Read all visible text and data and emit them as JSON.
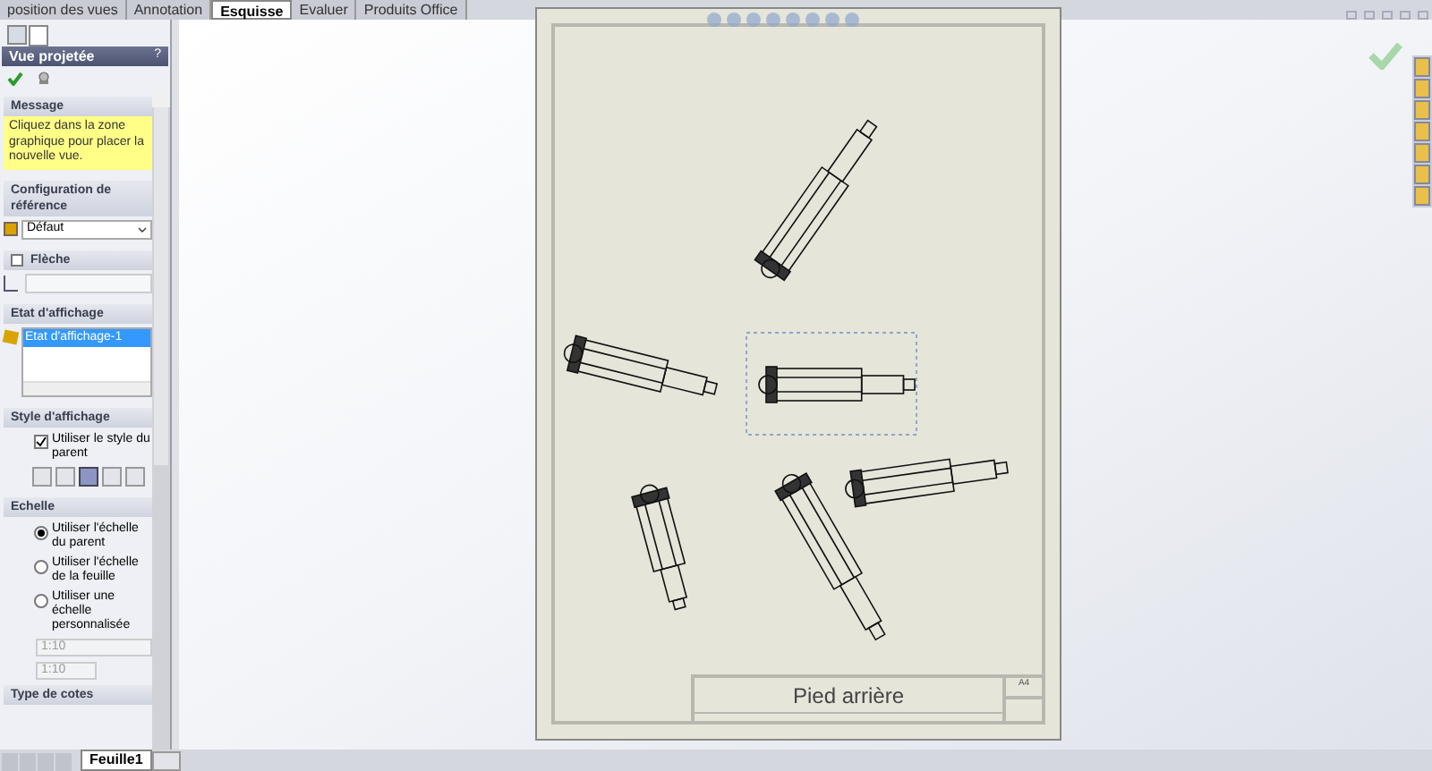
{
  "ribbon_tabs": [
    {
      "label": "position des vues",
      "selected": false
    },
    {
      "label": "Annotation",
      "selected": false
    },
    {
      "label": "Esquisse",
      "selected": true
    },
    {
      "label": "Evaluer",
      "selected": false
    },
    {
      "label": "Produits Office",
      "selected": false
    }
  ],
  "panel": {
    "title": "Vue projetée",
    "help": "?",
    "message": {
      "header": "Message",
      "text": "Cliquez dans la zone graphique pour placer la nouvelle vue."
    },
    "config": {
      "header": "Configuration de référence",
      "value": "Défaut"
    },
    "arrow": {
      "header": "Flèche",
      "checked": false
    },
    "display_state": {
      "header": "Etat d'affichage",
      "items": [
        {
          "label": "Etat d'affichage-1",
          "selected": true
        }
      ]
    },
    "display_style": {
      "header": "Style d'affichage",
      "use_parent": {
        "label": "Utiliser le style du parent",
        "checked": true
      },
      "buttons": [
        {
          "selected": false
        },
        {
          "selected": false
        },
        {
          "selected": true
        },
        {
          "selected": false
        },
        {
          "selected": false
        }
      ]
    },
    "scale": {
      "header": "Echelle",
      "options": [
        {
          "label": "Utiliser l'échelle du parent",
          "selected": true
        },
        {
          "label": "Utiliser l'échelle de la feuille",
          "selected": false
        },
        {
          "label": "Utiliser une échelle personnalisée",
          "selected": false
        }
      ],
      "custom_select": "1:10",
      "custom_field": "1:10"
    },
    "next_header": "Type de cotes"
  },
  "sheet": {
    "title": "Pied arrière",
    "size": "A4"
  },
  "sheet_tabs": [
    {
      "label": "Feuille1",
      "selected": true
    }
  ]
}
